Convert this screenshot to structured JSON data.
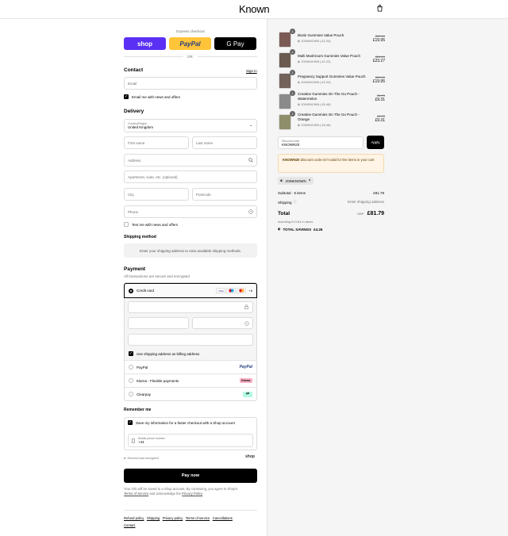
{
  "header": {
    "logo": "Known",
    "cart_icon": "shopping-bag-icon"
  },
  "express": {
    "title": "Express checkout",
    "shop_label": "shop",
    "paypal_label": "PayPal",
    "gpay_label": "G Pay",
    "or": "OR",
    "colors": {
      "shop": "#5a31f4",
      "paypal": "#ffc439",
      "gpay": "#000000"
    }
  },
  "contact": {
    "title": "Contact",
    "sign_in": "Sign in",
    "email_placeholder": "Email",
    "newsletter": "Email me with news and offers"
  },
  "delivery": {
    "title": "Delivery",
    "country_label": "Country/Region",
    "country_value": "United Kingdom",
    "first_name": "First name",
    "last_name": "Last name",
    "address": "Address",
    "apartment": "Apartment, suite, etc. (optional)",
    "city": "City",
    "postcode": "Postcode",
    "phone": "Phone",
    "text_offers": "Text me with news and offers"
  },
  "shipping": {
    "title": "Shipping method",
    "notice": "Enter your shipping address to view available shipping methods."
  },
  "payment": {
    "title": "Payment",
    "subtitle": "All transactions are secure and encrypted.",
    "credit_card": "Credit card",
    "card_icons": [
      "VISA",
      "MC",
      "MC",
      "+5"
    ],
    "billing_same": "Use shipping address as billing address",
    "paypal": "PayPal",
    "paypal_logo": "PayPal",
    "klarna": "Klarna - Flexible payments",
    "klarna_logo": "Klarna.",
    "clearpay": "Clearpay"
  },
  "remember": {
    "title": "Remember me",
    "save_info": "Save my information for a faster checkout with a Shop account",
    "mobile_label": "Mobile phone number",
    "mobile_value": "+44",
    "secure": "Secured and encrypted",
    "shop_logo": "shop"
  },
  "pay_now": "Pay now",
  "legal": {
    "text": "Your info will be saved to a Shop account. By continuing, you agree to Shop's",
    "terms": "Terms of Service",
    "and": "and acknowledge the",
    "privacy": "Privacy Policy"
  },
  "footer": [
    "Refund policy",
    "Shipping",
    "Privacy policy",
    "Terms of service",
    "Cancellations",
    "Contact"
  ],
  "cart": {
    "items": [
      {
        "qty": "1",
        "name": "Biotin Gummies Value Pouch",
        "tag": "JOINKNOWN (-£1.04)",
        "old": "£20.99",
        "price": "£19.95",
        "color": "#7b5a55"
      },
      {
        "qty": "1",
        "name": "Multi Mushroom Gummies Value Pouch",
        "tag": "JOINKNOWN (-£1.22)",
        "old": "£24.49",
        "price": "£23.27",
        "color": "#6b5a50"
      },
      {
        "qty": "1",
        "name": "Pregnancy Support Gummies Value Pouch",
        "tag": "JOINKNOWN (-£1.04)",
        "old": "£20.99",
        "price": "£19.95",
        "color": "#73625a"
      },
      {
        "qty": "1",
        "name": "Creatine Gummies On The Go Pouch - Watermelon",
        "tag": "JOINKNOWN (-£0.48)",
        "old": "£9.79",
        "price": "£9.31",
        "color": "#8a8a8a"
      },
      {
        "qty": "1",
        "name": "Creatine Gummies On The Go Pouch - Orange",
        "tag": "JOINKNOWN (-£0.48)",
        "old": "£9.79",
        "price": "£9.31",
        "color": "#8e8f6a"
      }
    ],
    "discount_label": "Discount code",
    "discount_value": "KNOWN20",
    "apply": "Apply",
    "error_code": "KNOWN20",
    "error_text": "discount code isn't valid for the items in your cart",
    "applied_code": "JOINKNOWN",
    "subtotal_label": "Subtotal · 5 items",
    "subtotal_value": "£81.79",
    "shipping_label": "Shipping",
    "shipping_value": "Enter shipping address",
    "total_label": "Total",
    "currency": "GBP",
    "total_value": "£81.79",
    "taxes": "Including £13.64 in taxes",
    "savings_label": "TOTAL SAVINGS",
    "savings_value": "£4.26"
  }
}
